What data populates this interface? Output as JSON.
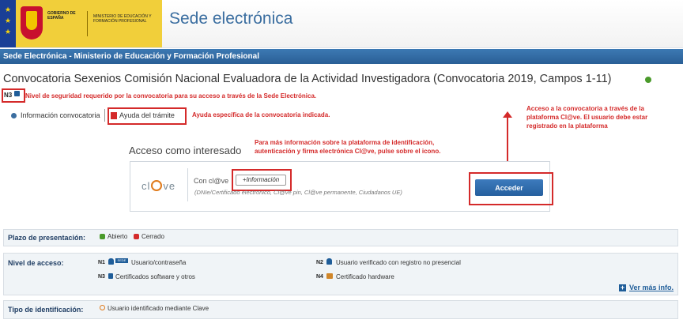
{
  "header": {
    "gov_text": "GOBIERNO DE ESPAÑA",
    "ministry_text": "MINISTERIO DE EDUCACIÓN Y FORMACIÓN PROFESIONAL",
    "site_title": "Sede electrónica"
  },
  "bluebar": {
    "text": "Sede Electrónica - Ministerio de Educación y Formación Profesional"
  },
  "page": {
    "title": "Convocatoria Sexenios Comisión Nacional Evaluadora de la Actividad Investigadora (Convocatoria 2019, Campos 1-11)",
    "security_level_code": "N3",
    "security_note": "Nivel de seguridad requerido por la convocatoria para su acceso a través de la Sede Electrónica."
  },
  "tabs": {
    "info_label": "Información convocatoria",
    "help_label": "Ayuda del trámite",
    "help_note": "Ayuda específica de la convocatoria indicada."
  },
  "notes": {
    "access_note": "Acceso a la convocatoria a través de la plataforma Cl@ve. El usuario debe estar registrado en la plataforma",
    "more_info_note": "Para más información sobre la plataforma de identificación, autenticación y firma electrónica Cl@ve, pulse sobre el icono."
  },
  "acceso": {
    "title": "Acceso como interesado",
    "logo_left": "cl",
    "logo_right": "ve",
    "con_clave": "Con cl@ve",
    "more_info_button": "+Información",
    "description": "(DNIe/Certificado electrónico, Cl@ve pin, Cl@ve permanente, Ciudadanos UE)",
    "acceder_button": "Acceder"
  },
  "plazo": {
    "label": "Plazo de presentación:",
    "open": "Abierto",
    "closed": "Cerrado"
  },
  "nivel": {
    "label": "Nivel de acceso:",
    "n1_code": "N1",
    "n1_badge": "SEDE",
    "n1_text": "Usuario/contraseña",
    "n2_code": "N2",
    "n2_text": "Usuario verificado con registro no presencial",
    "n3_code": "N3",
    "n3_text": "Certificados software y otros",
    "n4_code": "N4",
    "n4_text": "Certificado hardware",
    "more_link": "Ver más info."
  },
  "tipo": {
    "label": "Tipo de identificación:",
    "value": "Usuario identificado mediante Clave"
  },
  "colors": {
    "brand_blue": "#2a5f96",
    "annotation_red": "#d42a2a",
    "clave_orange": "#e07a1a"
  }
}
